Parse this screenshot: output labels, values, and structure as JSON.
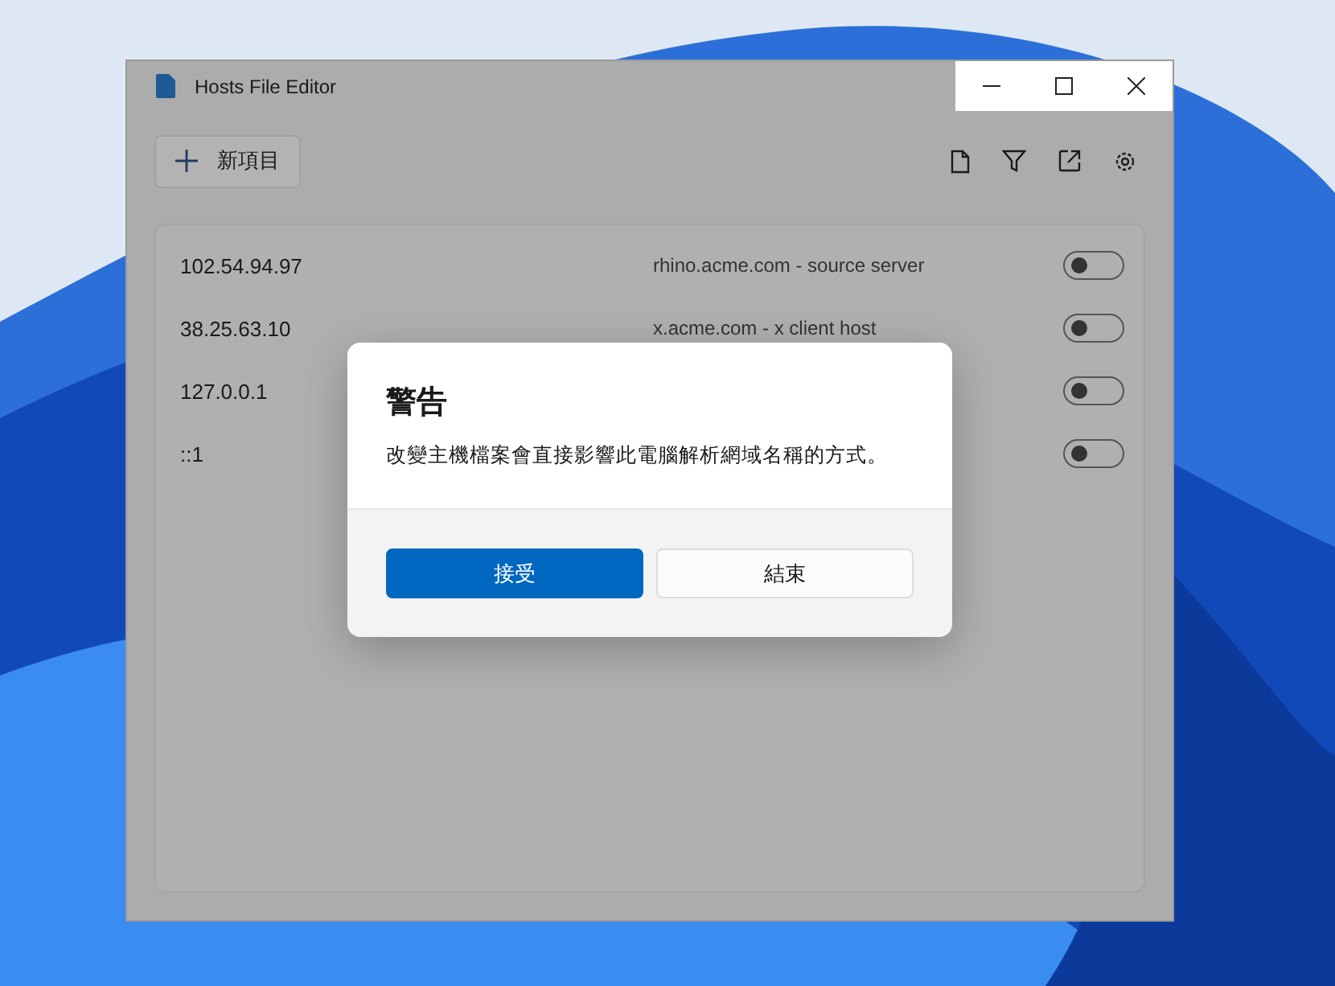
{
  "window": {
    "title": "Hosts File Editor"
  },
  "toolbar": {
    "new_button": "新項目"
  },
  "entries": [
    {
      "address": "102.54.94.97",
      "description": "rhino.acme.com - source server",
      "on": false
    },
    {
      "address": "38.25.63.10",
      "description": "x.acme.com - x client host",
      "on": false
    },
    {
      "address": "127.0.0.1",
      "on": false
    },
    {
      "address": "::1",
      "on": false
    }
  ],
  "dialog": {
    "title": "警告",
    "message": "改變主機檔案會直接影響此電腦解析網域名稱的方式。",
    "buttons": [
      {
        "label": "接受",
        "kind": "primary"
      },
      {
        "label": "結束",
        "kind": "secondary"
      }
    ]
  }
}
